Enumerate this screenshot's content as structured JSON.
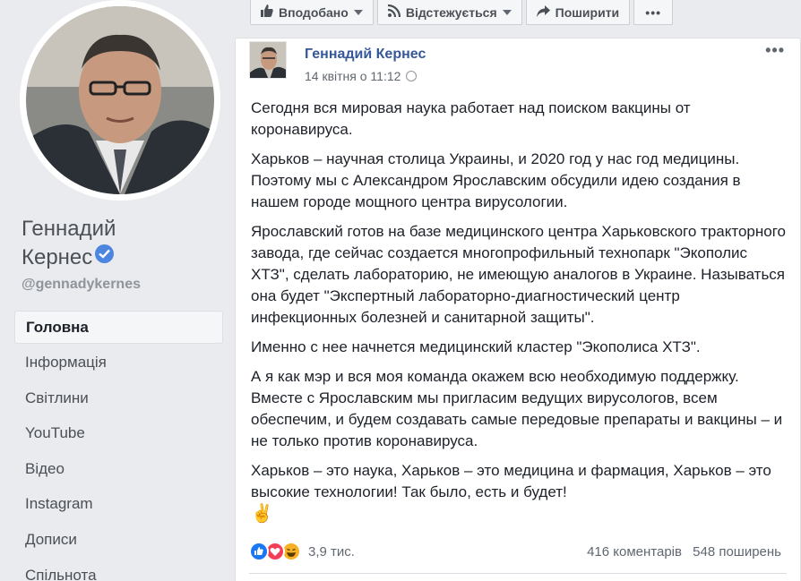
{
  "profile": {
    "name_line1": "Геннадий",
    "name_line2": "Кернес",
    "handle": "@gennadykernes",
    "verified_icon": "verified-badge-icon"
  },
  "nav": {
    "items": [
      {
        "label": "Головна",
        "active": true
      },
      {
        "label": "Інформація"
      },
      {
        "label": "Світлини"
      },
      {
        "label": "YouTube"
      },
      {
        "label": "Відео"
      },
      {
        "label": "Instagram"
      },
      {
        "label": "Дописи"
      },
      {
        "label": "Спільнота"
      }
    ]
  },
  "actions": {
    "liked": "Вподобано",
    "following": "Відстежується",
    "share": "Поширити",
    "more": "•••"
  },
  "post": {
    "author": "Геннадий Кернес",
    "date": "14 квітня о 11:12",
    "menu": "•••",
    "paragraphs": [
      "Сегодня вся мировая наука работает над поиском вакцины от коронавируса.",
      "Харьков – научная столица Украины, и 2020 год у нас год медицины. Поэтому мы с Александром Ярославским обсудили идею создания в нашем городе мощного центра вирусологии.",
      "Ярославский готов на базе медицинского центра Харьковского тракторного завода, где сейчас создается многопрофильный технопарк \"Экополис ХТЗ\", сделать лабораторию, не имеющую аналогов в Украине. Называться она будет \"Экспертный лабораторно-диагностический центр инфекционных болезней и санитарной защиты\".",
      "Именно с нее начнется медицинский кластер \"Экополиса ХТЗ\".",
      "А я как мэр и вся моя команда окажем всю необходимую поддержку. Вместе с Ярославским мы пригласим ведущих вирусологов, всем обеспечим, и будем создавать самые передовые препараты и вакцины – и не только против коронавируса.",
      "Харьков – это наука, Харьков – это медицина и фармация, Харьков – это высокие технологии! Так было, есть и будет!"
    ],
    "emoji": "✌️",
    "reactions_count": "3,9 тис.",
    "comments": "416 коментарів",
    "shares": "548 поширень"
  },
  "colors": {
    "link": "#365899",
    "background": "#e9ebee",
    "like": "#1877f2",
    "love": "#f33e58",
    "haha": "#f7b125"
  }
}
